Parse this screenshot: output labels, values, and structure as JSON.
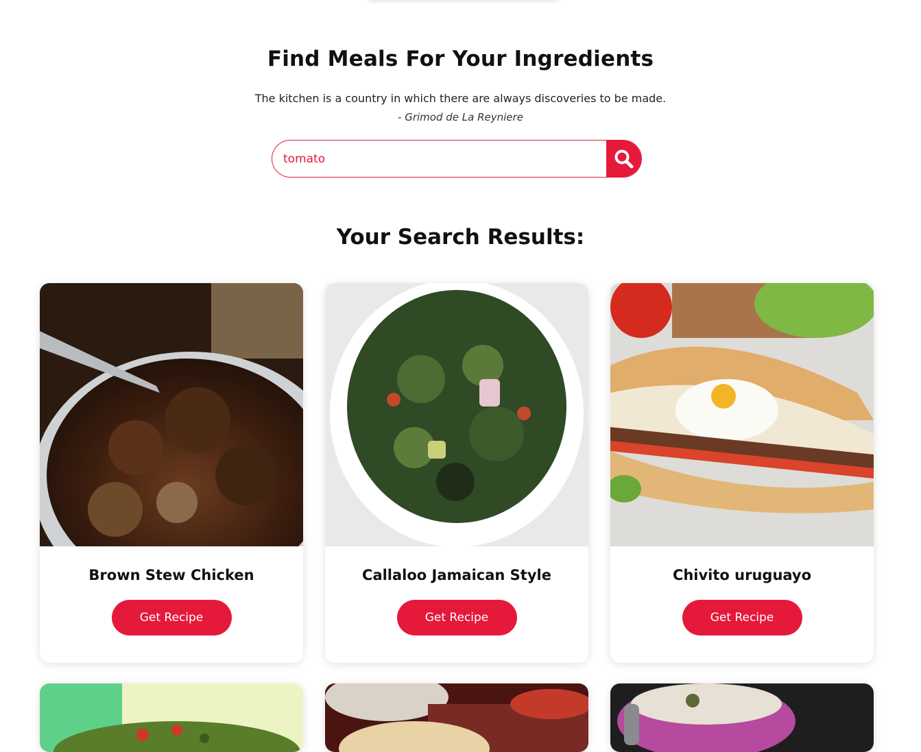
{
  "header": {
    "title": "Find Meals For Your Ingredients",
    "quote": "The kitchen is a country in which there are always discoveries to be made.",
    "quote_author": "- Grimod de La Reyniere"
  },
  "search": {
    "value": "tomato",
    "placeholder": ""
  },
  "results": {
    "title": "Your Search Results:",
    "button_label": "Get Recipe",
    "meals": [
      {
        "name": "Brown Stew Chicken"
      },
      {
        "name": "Callaloo Jamaican Style"
      },
      {
        "name": "Chivito uruguayo"
      }
    ]
  },
  "colors": {
    "accent": "#e5193a"
  }
}
